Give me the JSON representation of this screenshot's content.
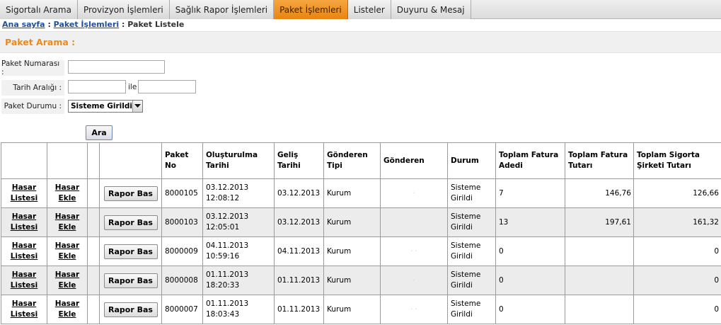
{
  "tabs": [
    {
      "label": "Sigortalı Arama",
      "active": false
    },
    {
      "label": "Provizyon İşlemleri",
      "active": false
    },
    {
      "label": "Sağlık Rapor İşlemleri",
      "active": false
    },
    {
      "label": "Paket İşlemleri",
      "active": true
    },
    {
      "label": "Listeler",
      "active": false
    },
    {
      "label": "Duyuru & Mesaj",
      "active": false
    }
  ],
  "breadcrumb": {
    "home": "Ana sayfa",
    "sep1": " : ",
    "section": "Paket İşlemleri",
    "sep2": " : ",
    "current": "Paket Listele"
  },
  "search": {
    "title": "Paket Arama :",
    "paket_no_label": "Paket Numarası :",
    "paket_no_value": "",
    "tarih_label": "Tarih Aralığı :",
    "tarih_start": "",
    "tarih_between": "ile",
    "tarih_end": "",
    "durum_label": "Paket Durumu :",
    "durum_selected": "Sisteme Girildi",
    "search_button": "Ara"
  },
  "table": {
    "headers": {
      "paket_no": "Paket No",
      "olusturulma": "Oluşturulma Tarihi",
      "gelis": "Geliş Tarihi",
      "gonderen_tipi": "Gönderen Tipi",
      "gonderen": "Gönderen",
      "durum": "Durum",
      "fatura_adedi": "Toplam Fatura Adedi",
      "fatura_tutari": "Toplam Fatura Tutarı",
      "sigorta_tutari": "Toplam Sigorta Şirketi Tutarı"
    },
    "hasar_listesi_label": "Hasar Listesi",
    "hasar_ekle_label": "Hasar Ekle",
    "rapor_bas_label": "Rapor Bas",
    "rows": [
      {
        "paket_no": "8000105",
        "olusturulma": "03.12.2013 12:08:12",
        "gelis": "03.12.2013",
        "gonderen_tipi": "Kurum",
        "gonderen": "·",
        "durum": "Sisteme Girildi",
        "fatura_adedi": "7",
        "fatura_tutari": "146,76",
        "sigorta_tutari": "126,66"
      },
      {
        "paket_no": "8000103",
        "olusturulma": "03.12.2013 12:05:01",
        "gelis": "03.12.2013",
        "gonderen_tipi": "Kurum",
        "gonderen": "",
        "durum": "Sisteme Girildi",
        "fatura_adedi": "13",
        "fatura_tutari": "197,61",
        "sigorta_tutari": "161,32"
      },
      {
        "paket_no": "8000009",
        "olusturulma": "04.11.2013 10:59:16",
        "gelis": "04.11.2013",
        "gonderen_tipi": "Kurum",
        "gonderen": "· ·",
        "durum": "Sisteme Girildi",
        "fatura_adedi": "0",
        "fatura_tutari": "",
        "sigorta_tutari": "0"
      },
      {
        "paket_no": "8000008",
        "olusturulma": "01.11.2013 18:20:33",
        "gelis": "01.11.2013",
        "gonderen_tipi": "Kurum",
        "gonderen": "·",
        "durum": "Sisteme Girildi",
        "fatura_adedi": "0",
        "fatura_tutari": "",
        "sigorta_tutari": "0"
      },
      {
        "paket_no": "8000007",
        "olusturulma": "01.11.2013 18:03:43",
        "gelis": "01.11.2013",
        "gonderen_tipi": "Kurum",
        "gonderen": "· ·",
        "durum": "Sisteme Girildi",
        "fatura_adedi": "0",
        "fatura_tutari": "",
        "sigorta_tutari": "0"
      }
    ]
  },
  "colors": {
    "accent": "#ed8a1a",
    "active_tab": "#f0952a",
    "link": "#1f4e9c",
    "row_alt": "#ececec"
  },
  "icons": {
    "select_arrow": "chevron-down-icon"
  }
}
